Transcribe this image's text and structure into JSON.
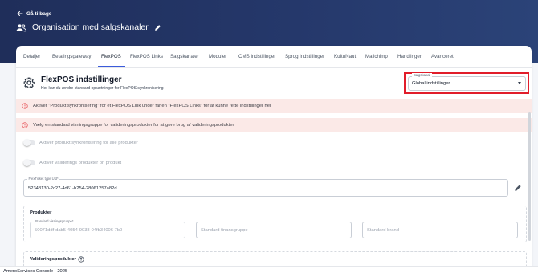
{
  "nav": {
    "back_label": "Gå tilbage"
  },
  "header": {
    "title": "Organisation med salgskanaler"
  },
  "tabs": [
    {
      "label": "Detaljer"
    },
    {
      "label": "Betalingsgateway"
    },
    {
      "label": "FlexPOS"
    },
    {
      "label": "FlexPOS Links"
    },
    {
      "label": "Salgskanaler"
    },
    {
      "label": "Moduler"
    },
    {
      "label": "CMS indstillinger"
    },
    {
      "label": "Sprog indstillinger"
    },
    {
      "label": "KultuNaut"
    },
    {
      "label": "Mailchimp"
    },
    {
      "label": "Handlinger"
    },
    {
      "label": "Avanceret"
    }
  ],
  "active_tab": "FlexPOS",
  "settings": {
    "title": "FlexPOS indstillinger",
    "subtitle": "Her kan du ændre standard opsætninger for FlexPOS synkronisering"
  },
  "sales_channel": {
    "label": "Salgskanal",
    "value": "Global indstillinger"
  },
  "alerts": [
    "Aktiver \"Produkt synkronisering\" for et FlexPOS Link under fanen \"FlexPOS Links\" for at kunne rette indstillinger her",
    "Vælg en standard visningsgruppe for valideringsprodukter for at gøre brug af valideringsprodukter"
  ],
  "toggles": [
    {
      "label": "Aktiver produkt synkronisering for alle produkter",
      "on": false
    },
    {
      "label": "Aktiver validerings produkter pr. produkt",
      "on": false
    }
  ],
  "ticket_field": {
    "label": "FlexTicket type Uid*",
    "value": "52348130-2c27-4d61-b254-28061257a82d"
  },
  "products": {
    "title": "Produkter",
    "display_group": {
      "label": "Standard visningsgruppe*",
      "value": "50071ddf-dab5-4054-9938-04fb34006 7b0"
    },
    "finance_group": {
      "placeholder": "Standard finansgruppe"
    },
    "brand": {
      "placeholder": "Standard brand"
    }
  },
  "validation": {
    "title": "Valideringsprodukter"
  },
  "footer": {
    "text": "AmeroServices Console - 2025"
  },
  "colors": {
    "header": "#25386b",
    "accent": "#3b5bdb",
    "highlight": "#e11d2a",
    "alert_bg": "#fbe9e7",
    "alert_icon": "#e5484d"
  }
}
